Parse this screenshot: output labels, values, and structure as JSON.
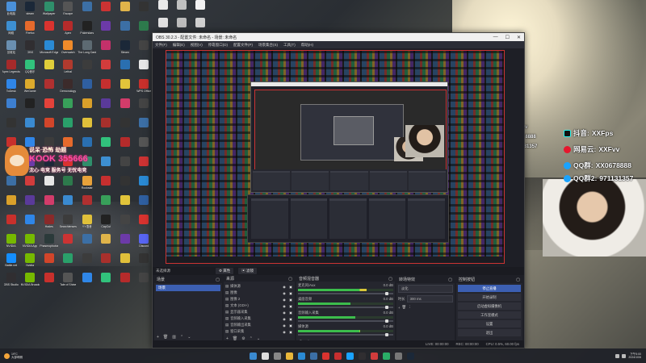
{
  "desktop": {
    "icons": [
      {
        "label": "此电脑",
        "color": "#4a90d9"
      },
      {
        "label": "steam",
        "color": "#1b2838"
      },
      {
        "label": "Wallpaper",
        "color": "#2f8f6b"
      },
      {
        "label": "Escape",
        "color": "#555"
      },
      {
        "label": "",
        "color": "#3c6fa5"
      },
      {
        "label": "",
        "color": "#c33"
      },
      {
        "label": "",
        "color": "#e0b44a"
      },
      {
        "label": "",
        "color": "#333"
      },
      {
        "label": "网络",
        "color": "#3d8fd1"
      },
      {
        "label": "Firefox",
        "color": "#e66a2c"
      },
      {
        "label": "",
        "color": "#d9332f"
      },
      {
        "label": "Apex",
        "color": "#b52b2b"
      },
      {
        "label": "Pokerstars",
        "color": "#222"
      },
      {
        "label": "",
        "color": "#6c3aa8"
      },
      {
        "label": "",
        "color": "#3c6fa5"
      },
      {
        "label": "",
        "color": "#2d7a4c"
      },
      {
        "label": "回收站",
        "color": "#6a8fb0"
      },
      {
        "label": "OBS",
        "color": "#302e31"
      },
      {
        "label": "Microsoft Edge",
        "color": "#2a8ad4"
      },
      {
        "label": "Overwatch",
        "color": "#f08b2a"
      },
      {
        "label": "The Long Dark",
        "color": "#5d6a72"
      },
      {
        "label": "",
        "color": "#c3316a"
      },
      {
        "label": "Steam",
        "color": "#1b2838"
      },
      {
        "label": "",
        "color": "#444"
      },
      {
        "label": "Apex Legends",
        "color": "#a62a2a"
      },
      {
        "label": "QQ音乐",
        "color": "#31c27c"
      },
      {
        "label": "",
        "color": "#e0ce3a"
      },
      {
        "label": "Lethal",
        "color": "#b03a2e"
      },
      {
        "label": "",
        "color": "#3c3c3c"
      },
      {
        "label": "",
        "color": "#d23c3c"
      },
      {
        "label": "",
        "color": "#2a6fb0"
      },
      {
        "label": "",
        "color": "#e6e6e6"
      },
      {
        "label": "ToDesk",
        "color": "#2f86e8"
      },
      {
        "label": "WeGame",
        "color": "#dcaa2c"
      },
      {
        "label": "",
        "color": "#b03030"
      },
      {
        "label": "Demonology",
        "color": "#3c2b2b"
      },
      {
        "label": "",
        "color": "#2f5fa0"
      },
      {
        "label": "",
        "color": "#c62f2f"
      },
      {
        "label": "",
        "color": "#e1c43a"
      },
      {
        "label": "WPS Office",
        "color": "#c8302c"
      },
      {
        "label": "",
        "color": "#3d7fd0"
      },
      {
        "label": "",
        "color": "#222"
      },
      {
        "label": "",
        "color": "#e4423a"
      },
      {
        "label": "",
        "color": "#38a05a"
      },
      {
        "label": "",
        "color": "#d9a02a"
      },
      {
        "label": "",
        "color": "#5a3a9a"
      },
      {
        "label": "",
        "color": "#d23c6a"
      },
      {
        "label": "",
        "color": "#444"
      },
      {
        "label": "",
        "color": "#333"
      },
      {
        "label": "",
        "color": "#3a8ad0"
      },
      {
        "label": "",
        "color": "#d2452a"
      },
      {
        "label": "",
        "color": "#2aa06a"
      },
      {
        "label": "",
        "color": "#e0c03a"
      },
      {
        "label": "",
        "color": "#a8302c"
      },
      {
        "label": "",
        "color": "#333"
      },
      {
        "label": "",
        "color": "#3c6fa5"
      },
      {
        "label": "",
        "color": "#c8302c"
      },
      {
        "label": "",
        "color": "#2f86e8"
      },
      {
        "label": "",
        "color": "#3c3c3c"
      },
      {
        "label": "",
        "color": "#e66a2c"
      },
      {
        "label": "",
        "color": "#2a6fb0"
      },
      {
        "label": "",
        "color": "#31c27c"
      },
      {
        "label": "",
        "color": "#b52b2b"
      },
      {
        "label": "",
        "color": "#555"
      },
      {
        "label": "",
        "color": "#e0b44a"
      },
      {
        "label": "",
        "color": "#6c3aa8"
      },
      {
        "label": "",
        "color": "#1b2838"
      },
      {
        "label": "",
        "color": "#d9332f"
      },
      {
        "label": "",
        "color": "#2f8f6b"
      },
      {
        "label": "",
        "color": "#3d8fd1"
      },
      {
        "label": "",
        "color": "#444"
      },
      {
        "label": "",
        "color": "#c33"
      },
      {
        "label": "",
        "color": "#3c6fa5"
      },
      {
        "label": "",
        "color": "#d23c3c"
      },
      {
        "label": "",
        "color": "#e6e6e6"
      },
      {
        "label": "",
        "color": "#2d7a4c"
      },
      {
        "label": "Rockstar",
        "color": "#e8a23a"
      },
      {
        "label": "",
        "color": "#c62f2f"
      },
      {
        "label": "",
        "color": "#333"
      },
      {
        "label": "",
        "color": "#2a8ad4"
      },
      {
        "label": "",
        "color": "#d9a02a"
      },
      {
        "label": "",
        "color": "#5a3a9a"
      },
      {
        "label": "",
        "color": "#d23c6a"
      },
      {
        "label": "",
        "color": "#3a8ad0"
      },
      {
        "label": "",
        "color": "#b03030"
      },
      {
        "label": "",
        "color": "#38a05a"
      },
      {
        "label": "",
        "color": "#e1c43a"
      },
      {
        "label": "",
        "color": "#2f5fa0"
      },
      {
        "label": "",
        "color": "#c8302c"
      },
      {
        "label": "",
        "color": "#2f86e8"
      },
      {
        "label": "Hades",
        "color": "#8a2a2a"
      },
      {
        "label": "Searchlenses",
        "color": "#3c3c3c"
      },
      {
        "label": "YY语音",
        "color": "#e0c03a"
      },
      {
        "label": "CapCut",
        "color": "#222"
      },
      {
        "label": "",
        "color": "#444"
      },
      {
        "label": "",
        "color": "#d9332f"
      },
      {
        "label": "NVIDIA",
        "color": "#76b900"
      },
      {
        "label": "NVIDIA App",
        "color": "#76b900"
      },
      {
        "label": "Phasmophobia",
        "color": "#2b3a3a"
      },
      {
        "label": "",
        "color": "#c33"
      },
      {
        "label": "",
        "color": "#3c6fa5"
      },
      {
        "label": "",
        "color": "#e0b44a"
      },
      {
        "label": "",
        "color": "#6c3aa8"
      },
      {
        "label": "Discord",
        "color": "#5865f2"
      },
      {
        "label": "Battle.net",
        "color": "#148eff"
      },
      {
        "label": "Nvidia",
        "color": "#76b900"
      },
      {
        "label": "",
        "color": "#d2452a"
      },
      {
        "label": "",
        "color": "#2aa06a"
      },
      {
        "label": "",
        "color": "#3c3c3c"
      },
      {
        "label": "",
        "color": "#a8302c"
      },
      {
        "label": "",
        "color": "#e0c03a"
      },
      {
        "label": "",
        "color": "#333"
      },
      {
        "label": "OBS Studio",
        "color": "#302e31"
      },
      {
        "label": "NVIDIA Broadcast",
        "color": "#76b900"
      },
      {
        "label": "",
        "color": "#c8302c"
      },
      {
        "label": "Tale of Shine",
        "color": "#555"
      },
      {
        "label": "",
        "color": "#2f86e8"
      },
      {
        "label": "",
        "color": "#31c27c"
      },
      {
        "label": "",
        "color": "#b52b2b"
      },
      {
        "label": "",
        "color": "#444"
      }
    ],
    "top_right_icons": [
      {
        "label": "",
        "color": "#e9e9e9"
      },
      {
        "label": "",
        "color": "#c0c0c0"
      },
      {
        "label": "",
        "color": "#f2f2f2"
      },
      {
        "label": "",
        "color": "#e0e0e0"
      },
      {
        "label": "",
        "color": "#bdbdbd"
      },
      {
        "label": "",
        "color": "#d0d0d0"
      }
    ],
    "kook_badge": {
      "line1": "说呆·恐怖 劫题",
      "line2": "KOOK 355666",
      "line3": "沈心·电竞 服务号 无忧电竞"
    }
  },
  "obs": {
    "title": "OBS 30.2.3 - 配置文件: 未命名 - 场景: 未命名",
    "window_controls": {
      "minimize": "—",
      "maximize": "☐",
      "close": "✕"
    },
    "menu": [
      "文件(F)",
      "编辑(E)",
      "视图(V)",
      "停靠窗口(D)",
      "配置文件(P)",
      "场景集合(S)",
      "工具(T)",
      "帮助(H)"
    ],
    "modebar": {
      "scene_name": "未选择源",
      "buttons": [
        "⚙ 属性",
        "▣ 滤镜"
      ]
    },
    "scenes": {
      "title": "场景",
      "items": [
        "场景"
      ]
    },
    "sources": {
      "title": "来源",
      "items": [
        "媒体源",
        "图像",
        "图像 2",
        "文本 (GDI+)",
        "显示器采集",
        "音频输入采集",
        "音频输出采集",
        "窗口采集"
      ]
    },
    "mixer": {
      "title": "音频混音器",
      "channels": [
        {
          "name": "麦克风/Aux",
          "db": "0.0 dB",
          "level": 0.72,
          "volume": 0.95
        },
        {
          "name": "桌面音频",
          "db": "0.0 dB",
          "level": 0.55,
          "volume": 0.95
        },
        {
          "name": "音频输入采集",
          "db": "0.0 dB",
          "level": 0.6,
          "volume": 0.95
        },
        {
          "name": "媒体源",
          "db": "0.0 dB",
          "level": 0.65,
          "volume": 0.95
        }
      ]
    },
    "transitions": {
      "title": "转场特效",
      "type": "淡化",
      "duration_label": "时长",
      "duration": "300 ms"
    },
    "controls": {
      "title": "控制按钮",
      "buttons": [
        "停止直播",
        "开始录制",
        "启动虚拟摄像机",
        "工作室模式",
        "设置",
        "退出"
      ]
    },
    "status": {
      "live": "LIVE: 00:00:00",
      "rec": "REC: 00:00:00",
      "cpu": "CPU: 0.5%, 60.00 fps"
    }
  },
  "overlay": {
    "rows": [
      {
        "kind": "tiktok",
        "label": "抖音",
        "value": "XXFps",
        "size": "small"
      },
      {
        "kind": "weibo",
        "label": "网易云:",
        "value": "XXFvv",
        "size": "small"
      },
      {
        "kind": "qq",
        "label": "QQ群:",
        "value": "XX0678888",
        "size": "small"
      },
      {
        "kind": "qq",
        "label": "QQ群2:",
        "value": "971131357",
        "size": "small"
      },
      {
        "kind": "tiktok",
        "label": "抖音:",
        "value": "XXFps",
        "size": "big"
      },
      {
        "kind": "weibo",
        "label": "网易云:",
        "value": "XXFvv",
        "size": "big"
      },
      {
        "kind": "qq",
        "label": "QQ群:",
        "value": "XX0678888",
        "size": "big"
      },
      {
        "kind": "qq",
        "label": "QQ群2:",
        "value": "971131357",
        "size": "big"
      }
    ]
  },
  "taskbar": {
    "weather": {
      "temp": "19°C",
      "desc": "大部晴朗"
    },
    "apps": [
      {
        "name": "windows-start",
        "color": "#3a8ad0"
      },
      {
        "name": "search",
        "color": "#ddd"
      },
      {
        "name": "task-view",
        "color": "#888"
      },
      {
        "name": "explorer",
        "color": "#e8b63a"
      },
      {
        "name": "edge",
        "color": "#2a8ad4"
      },
      {
        "name": "store",
        "color": "#3c6fa5"
      },
      {
        "name": "chrome",
        "color": "#d9332f"
      },
      {
        "name": "netease-music",
        "color": "#c62f2f"
      },
      {
        "name": "qq",
        "color": "#1aa3ff"
      },
      {
        "name": "obs",
        "color": "#302e31"
      },
      {
        "name": "app-red",
        "color": "#d23c3c"
      },
      {
        "name": "wechat",
        "color": "#2aae67"
      },
      {
        "name": "app-gray",
        "color": "#777"
      },
      {
        "name": "steam",
        "color": "#1b2838"
      }
    ],
    "clock": {
      "time": "下午5:00",
      "date": "2024/10/6"
    }
  }
}
